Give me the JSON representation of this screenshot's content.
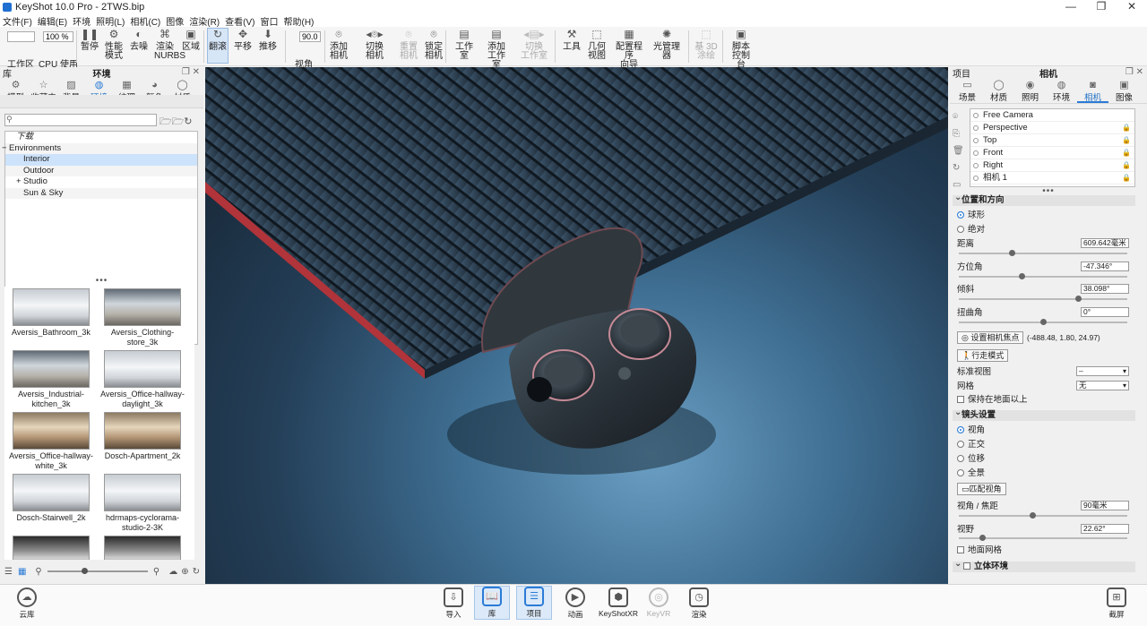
{
  "window": {
    "title": "KeyShot 10.0 Pro  - 2TWS.bip"
  },
  "menu": [
    "文件(F)",
    "编辑(E)",
    "环境",
    "照明(L)",
    "相机(C)",
    "图像",
    "渲染(R)",
    "查看(V)",
    "窗口",
    "帮助(H)"
  ],
  "toolbar": {
    "workspace_value": "",
    "zoom_value": "100 %",
    "fov_value": "90.0",
    "buttons": [
      {
        "id": "workspace",
        "label": "工作区",
        "icon": "workspace-icon"
      },
      {
        "id": "cpu",
        "label": "CPU 使用量",
        "icon": "cpu-icon"
      },
      {
        "id": "pause",
        "label": "暂停",
        "icon": "pause-icon"
      },
      {
        "id": "perf",
        "label": "性能\n模式",
        "icon": "performance-icon"
      },
      {
        "id": "denoise",
        "label": "去噪",
        "icon": "denoise-icon"
      },
      {
        "id": "nurbs",
        "label": "渲染\nNURBS",
        "icon": "nurbs-icon"
      },
      {
        "id": "region",
        "label": "区域",
        "icon": "region-icon"
      },
      {
        "id": "tumble",
        "label": "翻滚",
        "icon": "tumble-icon",
        "active": true
      },
      {
        "id": "pan",
        "label": "平移",
        "icon": "pan-icon"
      },
      {
        "id": "dolly",
        "label": "推移",
        "icon": "dolly-icon"
      },
      {
        "id": "fov",
        "label": "视角",
        "icon": "fov-icon"
      },
      {
        "id": "addcam",
        "label": "添加\n相机",
        "icon": "add-camera-icon"
      },
      {
        "id": "switchcam",
        "label": "切换\n相机",
        "icon": "switch-camera-icon"
      },
      {
        "id": "resetcam",
        "label": "重置\n相机",
        "icon": "reset-camera-icon",
        "disabled": true
      },
      {
        "id": "lockcam",
        "label": "锁定\n相机",
        "icon": "lock-camera-icon"
      },
      {
        "id": "studio",
        "label": "工作室",
        "icon": "studio-icon"
      },
      {
        "id": "addstudio",
        "label": "添加\n工作室",
        "icon": "add-studio-icon"
      },
      {
        "id": "switchstudio",
        "label": "切换\n工作室",
        "icon": "switch-studio-icon",
        "disabled": true
      },
      {
        "id": "tools",
        "label": "工具",
        "icon": "tools-icon"
      },
      {
        "id": "geoview",
        "label": "几何\n视图",
        "icon": "geometry-view-icon"
      },
      {
        "id": "configurator",
        "label": "配置程序\n向导",
        "icon": "configurator-icon"
      },
      {
        "id": "lightmgr",
        "label": "光管理器",
        "icon": "light-manager-icon"
      },
      {
        "id": "3dpaint",
        "label": "基 3D\n涂绘",
        "icon": "3d-paint-icon",
        "disabled": true
      },
      {
        "id": "scriptcon",
        "label": "脚本\n控制台",
        "icon": "script-console-icon"
      }
    ]
  },
  "left": {
    "panel_title": "库",
    "center_title": "环境",
    "tabs": [
      {
        "label": "模型",
        "icon": "model-icon"
      },
      {
        "label": "收藏夹",
        "icon": "star-icon"
      },
      {
        "label": "背景",
        "icon": "background-icon"
      },
      {
        "label": "环境",
        "icon": "globe-icon",
        "active": true
      },
      {
        "label": "纹理",
        "icon": "texture-icon"
      },
      {
        "label": "颜色",
        "icon": "color-icon"
      },
      {
        "label": "材质",
        "icon": "material-icon"
      }
    ],
    "search_placeholder": "",
    "tree": [
      {
        "label": "下载",
        "indent": 1
      },
      {
        "label": "Environments",
        "indent": 0,
        "exp": "−"
      },
      {
        "label": "Interior",
        "indent": 2,
        "sel": true
      },
      {
        "label": "Outdoor",
        "indent": 2
      },
      {
        "label": "Studio",
        "indent": 2,
        "exp": "+"
      },
      {
        "label": "Sun & Sky",
        "indent": 2
      }
    ],
    "thumbs": [
      {
        "label": "Aversis_Bathroom_3k",
        "style": "white"
      },
      {
        "label": "Aversis_Clothing-store_3k",
        "style": "indoor"
      },
      {
        "label": "Aversis_Industrial-kitchen_3k",
        "style": "indoor"
      },
      {
        "label": "Aversis_Office-hallway-daylight_3k",
        "style": "white"
      },
      {
        "label": "Aversis_Office-hallway-white_3k",
        "style": "warm"
      },
      {
        "label": "Dosch-Apartment_2k",
        "style": "warm"
      },
      {
        "label": "Dosch-Stairwell_2k",
        "style": "white"
      },
      {
        "label": "hdrmaps-cyclorama-studio-2-3K",
        "style": "white"
      },
      {
        "label": "",
        "style": "dark"
      },
      {
        "label": "",
        "style": "dark"
      }
    ]
  },
  "right": {
    "panel_title": "项目",
    "center_title": "相机",
    "tabs": [
      {
        "label": "场景",
        "icon": "scene-icon"
      },
      {
        "label": "材质",
        "icon": "material-icon"
      },
      {
        "label": "照明",
        "icon": "light-icon"
      },
      {
        "label": "环境",
        "icon": "globe-icon"
      },
      {
        "label": "相机",
        "icon": "camera-icon",
        "active": true
      },
      {
        "label": "图像",
        "icon": "image-icon"
      }
    ],
    "cameras": [
      "Free Camera",
      "Perspective",
      "Top",
      "Front",
      "Right",
      "相机 1"
    ],
    "section_position": "位置和方向",
    "mode_spherical": "球形",
    "mode_absolute": "绝对",
    "distance_label": "距离",
    "distance_value": "609.642毫米",
    "azimuth_label": "方位角",
    "azimuth_value": "-47.346°",
    "inclination_label": "倾斜",
    "inclination_value": "38.098°",
    "twist_label": "扭曲角",
    "twist_value": "0°",
    "set_focus_btn": "设置相机焦点",
    "focus_coords": "(-488.48, 1.80, 24.97)",
    "walk_mode_btn": "行走模式",
    "std_view_label": "标准视图",
    "std_view_value": "–",
    "grid_label": "网格",
    "grid_value": "无",
    "keep_above_ground": "保持在地面以上",
    "section_lens": "镜头设置",
    "lens_perspective": "视角",
    "lens_ortho": "正交",
    "lens_shift": "位移",
    "lens_pano": "全景",
    "match_persp_btn": "匹配视角",
    "fov_focal_label": "视角 / 焦距",
    "fov_focal_value": "90毫米",
    "fov_label": "视野",
    "fov_value": "22.62°",
    "ground_grid": "地面网格",
    "section_stereo": "立体环境"
  },
  "bottom": {
    "cloud": "云库",
    "items": [
      {
        "label": "导入",
        "icon": "import-icon"
      },
      {
        "label": "库",
        "icon": "library-icon",
        "active": true
      },
      {
        "label": "项目",
        "icon": "project-icon",
        "active": true
      },
      {
        "label": "动画",
        "icon": "animation-icon"
      },
      {
        "label": "KeyShotXR",
        "icon": "keyshotxr-icon"
      },
      {
        "label": "KeyVR",
        "icon": "keyvr-icon",
        "disabled": true
      },
      {
        "label": "渲染",
        "icon": "render-icon"
      }
    ],
    "screenshot": "截屏"
  }
}
